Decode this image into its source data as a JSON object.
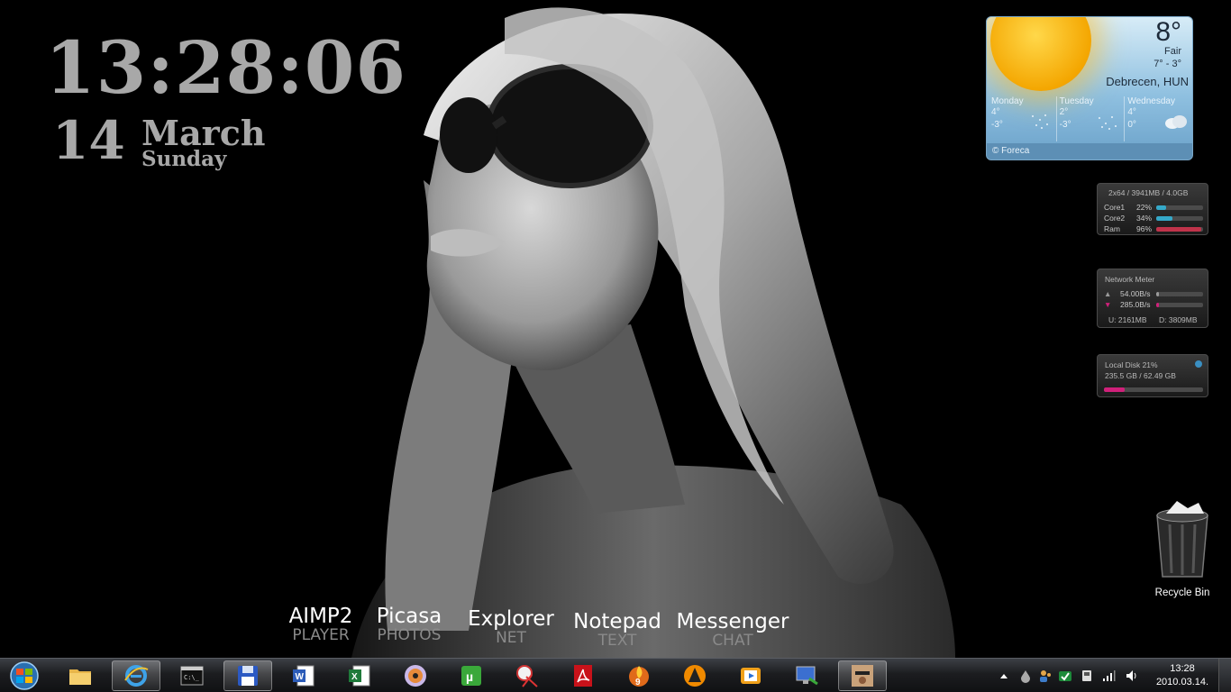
{
  "clock": {
    "time": "13:28:06",
    "day": "14",
    "month": "March",
    "weekday": "Sunday"
  },
  "weather": {
    "temperature": "8°",
    "condition": "Fair",
    "range": "7° - 3°",
    "city": "Debrecen, HUN",
    "forecast": [
      {
        "day": "Monday",
        "high": "4°",
        "low": "-3°",
        "icon": "snow-icon"
      },
      {
        "day": "Tuesday",
        "high": "2°",
        "low": "-3°",
        "icon": "snow-icon"
      },
      {
        "day": "Wednesday",
        "high": "4°",
        "low": "0°",
        "icon": "cloud-icon"
      }
    ],
    "credit": "© Foreca"
  },
  "cpu_meter": {
    "header": "2x64 / 3941MB / 4.0GB",
    "rows": [
      {
        "label": "Core1",
        "value": "22%",
        "level": 0.22,
        "color": "#35a9c9"
      },
      {
        "label": "Core2",
        "value": "34%",
        "level": 0.34,
        "color": "#35a9c9"
      },
      {
        "label": "Ram",
        "value": "96%",
        "level": 0.96,
        "color": "#c0334a"
      }
    ]
  },
  "network_meter": {
    "title": "Network Meter",
    "upload_rate": "54.00B/s",
    "download_rate": "285.0B/s",
    "upload_level": 0.05,
    "download_level": 0.05,
    "totals_up": "U: 2161MB",
    "totals_down": "D: 3809MB",
    "up_color": "#9a9a9a",
    "down_color": "#d0207a"
  },
  "disk_meter": {
    "title": "Local Disk  21%",
    "detail": "235.5 GB / 62.49 GB",
    "level": 0.21,
    "color": "#d0207a"
  },
  "recycle_bin": {
    "label": "Recycle Bin"
  },
  "dock": [
    {
      "name": "AIMP2",
      "sub": "PLAYER"
    },
    {
      "name": "Picasa",
      "sub": "PHOTOS"
    },
    {
      "name": "Explorer",
      "sub": "NET"
    },
    {
      "name": "Notepad",
      "sub": "TEXT"
    },
    {
      "name": "Messenger",
      "sub": "CHAT"
    }
  ],
  "taskbar": {
    "buttons": [
      {
        "icon": "folder-icon",
        "active": false
      },
      {
        "icon": "internet-explorer-icon",
        "active": true
      },
      {
        "icon": "command-prompt-icon",
        "active": false
      },
      {
        "icon": "floppy-disk-icon",
        "active": true
      },
      {
        "icon": "word-icon",
        "active": false
      },
      {
        "icon": "excel-icon",
        "active": false
      },
      {
        "icon": "disc-burner-icon",
        "active": false
      },
      {
        "icon": "utorrent-icon",
        "active": false
      },
      {
        "icon": "snipping-tool-icon",
        "active": false
      },
      {
        "icon": "acrobat-icon",
        "active": false
      },
      {
        "icon": "nero-icon",
        "active": false
      },
      {
        "icon": "vlc-icon",
        "active": false
      },
      {
        "icon": "media-player-icon",
        "active": false
      },
      {
        "icon": "remote-desktop-icon",
        "active": false
      },
      {
        "icon": "game-icon",
        "active": true
      }
    ],
    "tray_icons": [
      "show-hidden-icons-icon",
      "water-drop-icon",
      "users-icon",
      "check-icon",
      "device-icon",
      "network-signal-icon",
      "volume-icon"
    ],
    "clock_time": "13:28",
    "clock_date": "2010.03.14."
  }
}
